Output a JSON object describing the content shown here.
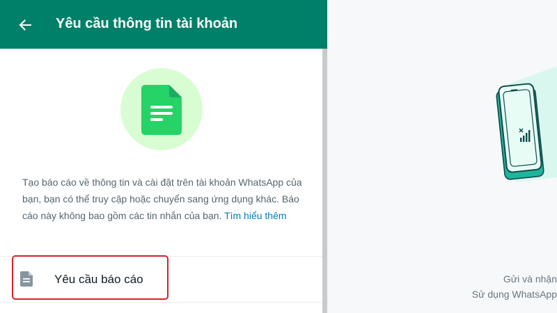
{
  "header": {
    "title": "Yêu cầu thông tin tài khoản",
    "back_icon": "arrow-left-icon"
  },
  "illustration": {
    "icon": "document-icon",
    "circle_color": "#d9fdd3",
    "icon_color": "#25d366"
  },
  "description": {
    "text": "Tạo báo cáo về thông tin và cài đặt trên tài khoản WhatsApp của bạn, bạn có thể truy cập hoặc chuyển sang ứng dụng khác. Báo cáo này không bao gồm các tin nhắn của bạn. ",
    "link": "Tìm hiểu thêm"
  },
  "request_row": {
    "label": "Yêu cầu báo cáo",
    "icon": "document-icon"
  },
  "right_panel": {
    "line1": "Gửi và nhận",
    "line2": "Sử dụng WhatsApp",
    "illustration": "phone-no-signal-icon"
  },
  "colors": {
    "header": "#008069",
    "link": "#027eb5",
    "highlight": "#d92027"
  }
}
